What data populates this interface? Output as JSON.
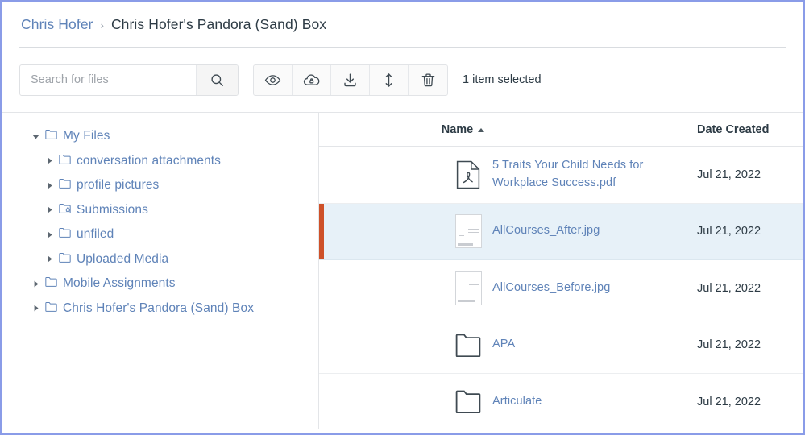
{
  "breadcrumb": {
    "root_label": "Chris Hofer",
    "separator": "›",
    "current_label": "Chris Hofer's Pandora (Sand) Box"
  },
  "toolbar": {
    "search": {
      "placeholder": "Search for files",
      "value": "",
      "button_icon": "search-icon"
    },
    "actions": [
      {
        "name": "preview",
        "icon": "eye-icon",
        "label": "Preview"
      },
      {
        "name": "publish",
        "icon": "cloud-lock-icon",
        "label": "Manage Access"
      },
      {
        "name": "download",
        "icon": "download-icon",
        "label": "Download"
      },
      {
        "name": "move",
        "icon": "move-updown-icon",
        "label": "Move To"
      },
      {
        "name": "delete",
        "icon": "trash-icon",
        "label": "Delete"
      }
    ],
    "selection_status": "1 item selected"
  },
  "sidebar": {
    "items": [
      {
        "label": "My Files",
        "level": 0,
        "expanded": true,
        "icon": "folder-icon"
      },
      {
        "label": "conversation attachments",
        "level": 1,
        "expanded": false,
        "icon": "folder-icon"
      },
      {
        "label": "profile pictures",
        "level": 1,
        "expanded": false,
        "icon": "folder-icon"
      },
      {
        "label": "Submissions",
        "level": 1,
        "expanded": false,
        "icon": "folder-lock-icon"
      },
      {
        "label": "unfiled",
        "level": 1,
        "expanded": false,
        "icon": "folder-icon"
      },
      {
        "label": "Uploaded Media",
        "level": 1,
        "expanded": false,
        "icon": "folder-icon"
      },
      {
        "label": "Mobile Assignments",
        "level": 0,
        "expanded": false,
        "icon": "folder-icon"
      },
      {
        "label": "Chris Hofer's Pandora (Sand) Box",
        "level": 0,
        "expanded": false,
        "icon": "folder-icon"
      }
    ]
  },
  "filelist": {
    "columns": {
      "name": "Name",
      "name_sort": "ascending",
      "date_created": "Date Created"
    },
    "rows": [
      {
        "name": "5 Traits Your Child Needs for Workplace Success.pdf",
        "date_created": "Jul 21, 2022",
        "icon": "pdf-file-icon",
        "selected": false
      },
      {
        "name": "AllCourses_After.jpg",
        "date_created": "Jul 21, 2022",
        "icon": "image-thumbnail",
        "selected": true
      },
      {
        "name": "AllCourses_Before.jpg",
        "date_created": "Jul 21, 2022",
        "icon": "image-thumbnail",
        "selected": false
      },
      {
        "name": "APA",
        "date_created": "Jul 21, 2022",
        "icon": "folder-icon",
        "selected": false
      },
      {
        "name": "Articulate",
        "date_created": "Jul 21, 2022",
        "icon": "folder-icon",
        "selected": false
      }
    ]
  },
  "colors": {
    "link": "#5f83b8",
    "text": "#2d3b45",
    "selected_row_bg": "#e7f1f8",
    "selection_marker": "#ce5129",
    "border": "#e3e5e8",
    "page_outline": "#8a9ce8"
  }
}
